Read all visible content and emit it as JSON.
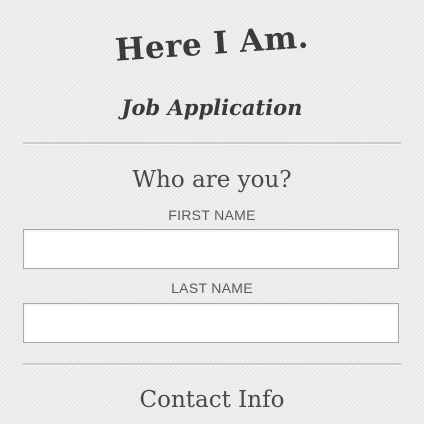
{
  "brand": {
    "title": "Here I Am."
  },
  "form": {
    "subtitle": "Job Application",
    "sections": [
      {
        "heading": "Who are you?",
        "fields": [
          {
            "label": "FIRST NAME",
            "value": ""
          },
          {
            "label": "LAST NAME",
            "value": ""
          }
        ]
      },
      {
        "heading": "Contact Info"
      }
    ]
  }
}
